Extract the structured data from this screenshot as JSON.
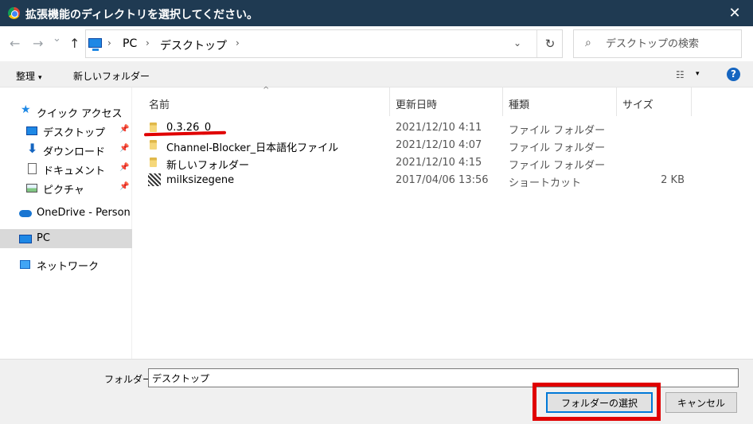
{
  "window": {
    "title": "拡張機能のディレクトリを選択してください。",
    "close_glyph": "✕"
  },
  "nav": {
    "back_glyph": "←",
    "forward_glyph": "→",
    "history_glyph": "⌄",
    "up_glyph": "↑",
    "breadcrumb": [
      "PC",
      "デスクトップ"
    ],
    "crumb_sep": "›",
    "dropdown_glyph": "⌄",
    "refresh_glyph": "↻",
    "search_placeholder": "デスクトップの検索",
    "search_glyph": "⌕"
  },
  "toolbar": {
    "organize_label": "整理",
    "new_folder_label": "新しいフォルダー",
    "view_glyph": "☷",
    "dropdown_glyph": "▾",
    "help_label": "?"
  },
  "sidebar": {
    "pin_glyph": "📌",
    "items": [
      {
        "label": "クイック アクセス",
        "icon": "star-icon"
      },
      {
        "label": "デスクトップ",
        "icon": "desktop-icon",
        "pinned": true
      },
      {
        "label": "ダウンロード",
        "icon": "download-icon",
        "pinned": true
      },
      {
        "label": "ドキュメント",
        "icon": "document-icon",
        "pinned": true
      },
      {
        "label": "ピクチャ",
        "icon": "pictures-icon",
        "pinned": true
      },
      {
        "label": "OneDrive - Personal",
        "icon": "onedrive-cloud-icon"
      },
      {
        "label": "PC",
        "icon": "pc-icon",
        "selected": true
      },
      {
        "label": "ネットワーク",
        "icon": "network-icon"
      }
    ]
  },
  "columns": {
    "name": "名前",
    "modified": "更新日時",
    "type": "種類",
    "size": "サイズ",
    "sort_glyph": "^"
  },
  "files": [
    {
      "name": "0.3.26_0",
      "modified": "2021/12/10 4:11",
      "type": "ファイル フォルダー",
      "size": "",
      "icon": "folder-icon"
    },
    {
      "name": "Channel-Blocker_日本語化ファイル",
      "modified": "2021/12/10 4:07",
      "type": "ファイル フォルダー",
      "size": "",
      "icon": "folder-icon"
    },
    {
      "name": "新しいフォルダー",
      "modified": "2021/12/10 4:15",
      "type": "ファイル フォルダー",
      "size": "",
      "icon": "folder-icon"
    },
    {
      "name": "milksizegene",
      "modified": "2017/04/06 13:56",
      "type": "ショートカット",
      "size": "2 KB",
      "icon": "shortcut-icon"
    }
  ],
  "footer": {
    "folder_label": "フォルダー:",
    "folder_value": "デスクトップ",
    "select_button": "フォルダーの選択",
    "cancel_button": "キャンセル"
  },
  "annotation_colors": {
    "highlight": "#e00000"
  }
}
